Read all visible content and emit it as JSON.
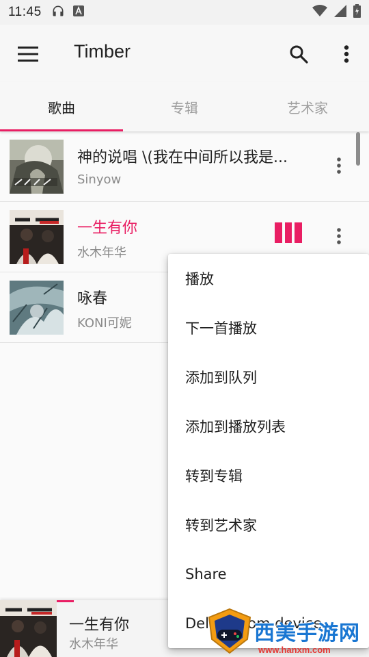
{
  "status_bar": {
    "time": "11:45"
  },
  "app_bar": {
    "title": "Timber",
    "icons": [
      "menu-icon",
      "search-icon",
      "more-vert-icon"
    ]
  },
  "tabs": [
    {
      "label": "歌曲",
      "active": true
    },
    {
      "label": "专辑",
      "active": false
    },
    {
      "label": "艺术家",
      "active": false
    }
  ],
  "songs": [
    {
      "title": "神的说唱 \\(我在中间所以我是...",
      "artist": "Sinyow",
      "playing": false
    },
    {
      "title": "一生有你",
      "artist": "水木年华",
      "playing": true
    },
    {
      "title": "咏春",
      "artist": "KONI可妮",
      "playing": false
    }
  ],
  "context_menu": {
    "items": [
      "播放",
      "下一首播放",
      "添加到队列",
      "添加到播放列表",
      "转到专辑",
      "转到艺术家",
      "Share",
      "Delete from device"
    ]
  },
  "now_playing": {
    "title": "一生有你",
    "artist": "水木年华",
    "progress": 0.2
  },
  "watermark": {
    "text": "西美手游网",
    "url": "www.hanxm.com"
  },
  "colors": {
    "accent": "#e91e63",
    "background": "#fafafa",
    "secondary_text": "#8a8a8a"
  }
}
